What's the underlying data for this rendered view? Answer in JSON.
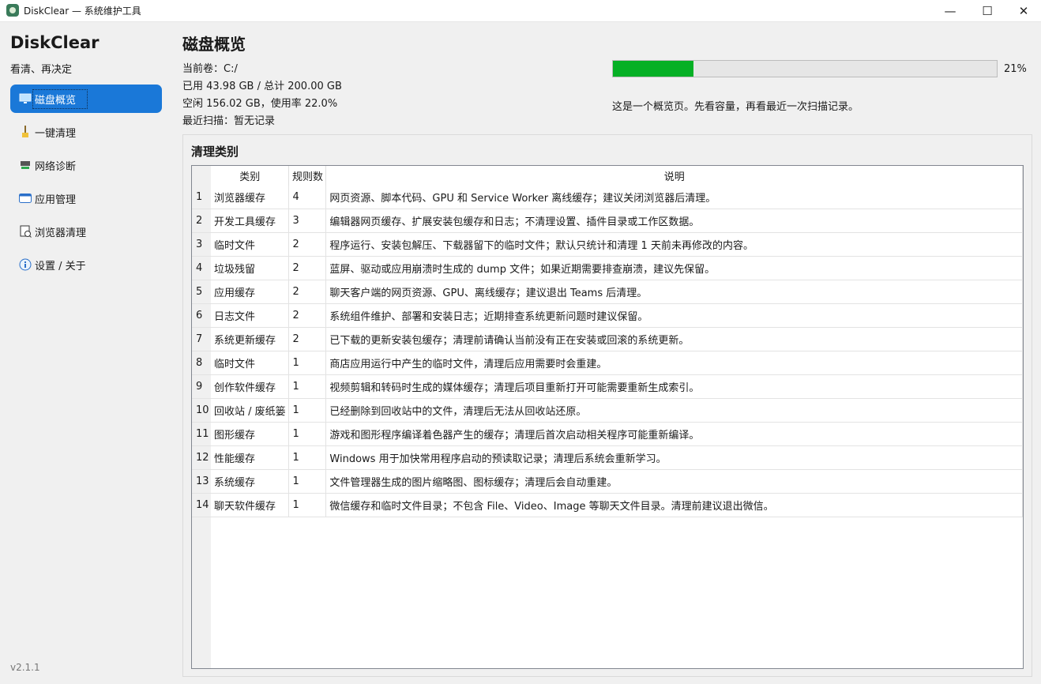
{
  "window": {
    "title": "DiskClear — 系统维护工具",
    "minimize_glyph": "—",
    "maximize_glyph": "☐",
    "close_glyph": "✕"
  },
  "sidebar": {
    "brand": "DiskClear",
    "tagline": "看清、再决定",
    "version": "v2.1.1",
    "items": [
      {
        "label": "磁盘概览",
        "icon": "monitor-icon",
        "active": true
      },
      {
        "label": "一键清理",
        "icon": "broom-icon",
        "active": false
      },
      {
        "label": "网络诊断",
        "icon": "network-icon",
        "active": false
      },
      {
        "label": "应用管理",
        "icon": "folder-icon",
        "active": false
      },
      {
        "label": "浏览器清理",
        "icon": "browser-icon",
        "active": false
      },
      {
        "label": "设置 / 关于",
        "icon": "info-icon",
        "active": false
      }
    ]
  },
  "main": {
    "title": "磁盘概览",
    "current_volume": "当前卷：C:/",
    "used_total": "已用 43.98 GB / 总计 200.00 GB",
    "free_usage": "空闲 156.02 GB，使用率 22.0%",
    "last_scan": "最近扫描：暂无记录",
    "usage_percent_value": 21,
    "usage_percent_label": "21%",
    "hint": "这是一个概览页。先看容量，再看最近一次扫描记录。",
    "progress_color": "#06b025"
  },
  "categories": {
    "title": "清理类别",
    "columns": [
      "",
      "类别",
      "规则数",
      "说明"
    ],
    "rows": [
      [
        "1",
        "浏览器缓存",
        "4",
        "网页资源、脚本代码、GPU 和 Service Worker 离线缓存；建议关闭浏览器后清理。"
      ],
      [
        "2",
        "开发工具缓存",
        "3",
        "编辑器网页缓存、扩展安装包缓存和日志；不清理设置、插件目录或工作区数据。"
      ],
      [
        "3",
        "临时文件",
        "2",
        "程序运行、安装包解压、下载器留下的临时文件；默认只统计和清理 1 天前未再修改的内容。"
      ],
      [
        "4",
        "垃圾残留",
        "2",
        "蓝屏、驱动或应用崩溃时生成的 dump 文件；如果近期需要排查崩溃，建议先保留。"
      ],
      [
        "5",
        "应用缓存",
        "2",
        "聊天客户端的网页资源、GPU、离线缓存；建议退出 Teams 后清理。"
      ],
      [
        "6",
        "日志文件",
        "2",
        "系统组件维护、部署和安装日志；近期排查系统更新问题时建议保留。"
      ],
      [
        "7",
        "系统更新缓存",
        "2",
        "已下载的更新安装包缓存；清理前请确认当前没有正在安装或回滚的系统更新。"
      ],
      [
        "8",
        "临时文件",
        "1",
        "商店应用运行中产生的临时文件，清理后应用需要时会重建。"
      ],
      [
        "9",
        "创作软件缓存",
        "1",
        "视频剪辑和转码时生成的媒体缓存；清理后项目重新打开可能需要重新生成索引。"
      ],
      [
        "10",
        "回收站 / 废纸篓",
        "1",
        "已经删除到回收站中的文件，清理后无法从回收站还原。"
      ],
      [
        "11",
        "图形缓存",
        "1",
        "游戏和图形程序编译着色器产生的缓存；清理后首次启动相关程序可能重新编译。"
      ],
      [
        "12",
        "性能缓存",
        "1",
        "Windows 用于加快常用程序启动的预读取记录；清理后系统会重新学习。"
      ],
      [
        "13",
        "系统缓存",
        "1",
        "文件管理器生成的图片缩略图、图标缓存；清理后会自动重建。"
      ],
      [
        "14",
        "聊天软件缓存",
        "1",
        "微信缓存和临时文件目录；不包含 File、Video、Image 等聊天文件目录。清理前建议退出微信。"
      ]
    ]
  }
}
